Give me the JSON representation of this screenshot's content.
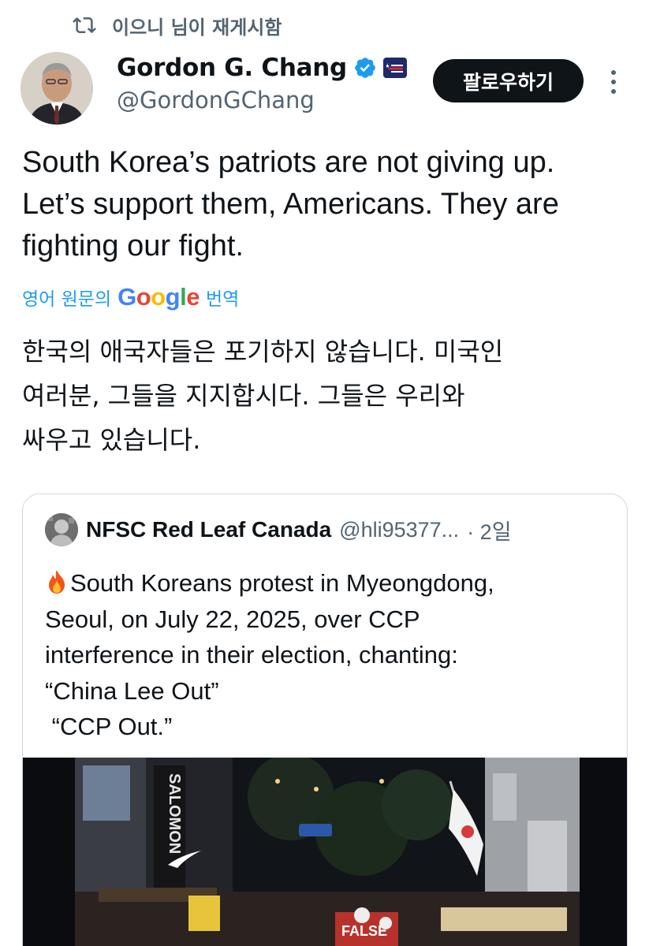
{
  "repost": {
    "text": "이으니 님이 재게시함",
    "icon": "repost-icon"
  },
  "author": {
    "name": "Gordon G. Chang",
    "handle": "@GordonGChang",
    "verified_icon": "verified-badge-icon",
    "affiliate_badge": "CPAC",
    "verified_color": "#1d9bf0"
  },
  "actions": {
    "follow_label": "팔로우하기",
    "more_icon": "more-vertical-icon"
  },
  "tweet": {
    "text": "South Korea’s patriots are not giving up.\nLet’s support them, Americans. They are\nfighting our fight."
  },
  "translation": {
    "prefix": "영어 원문의",
    "brand": "Google",
    "suffix": "번역",
    "text": "한국의 애국자들은 포기하지 않습니다. 미국인\n여러분, 그들을 지지합시다. 그들은 우리와\n싸우고 있습니다."
  },
  "quote": {
    "name": "NFSC Red Leaf Canada",
    "handle": "@hli95377...",
    "time": "· 2일",
    "emoji_icon": "fire-icon",
    "text": "South Koreans protest in Myeongdong,\nSeoul, on July 22, 2025, over CCP\ninterference in their election, chanting:\n“China Lee Out”\n “CCP Out.”",
    "media_sign": "SALOMON",
    "banner_text": "FALSE"
  },
  "colors": {
    "text": "#0f1419",
    "secondary": "#536471",
    "accent": "#1d9bf0",
    "border": "#cfd9de"
  }
}
